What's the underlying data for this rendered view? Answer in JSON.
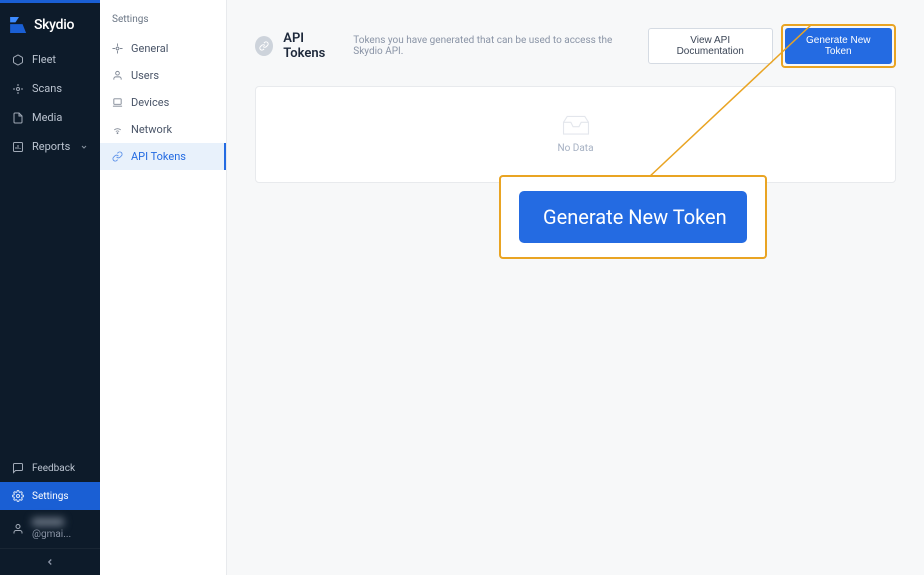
{
  "brand": {
    "name": "Skydio"
  },
  "primary_nav": {
    "items": [
      {
        "label": "Fleet",
        "icon": "cube"
      },
      {
        "label": "Scans",
        "icon": "scan"
      },
      {
        "label": "Media",
        "icon": "document"
      },
      {
        "label": "Reports",
        "icon": "report",
        "has_children": true
      }
    ],
    "footer": [
      {
        "label": "Feedback",
        "icon": "chat"
      },
      {
        "label": "Settings",
        "icon": "gear",
        "active": true
      }
    ],
    "user_suffix": "@gmai..."
  },
  "secondary_nav": {
    "title": "Settings",
    "items": [
      {
        "label": "General",
        "icon": "gear"
      },
      {
        "label": "Users",
        "icon": "user"
      },
      {
        "label": "Devices",
        "icon": "device"
      },
      {
        "label": "Network",
        "icon": "wifi"
      },
      {
        "label": "API Tokens",
        "icon": "link",
        "active": true
      }
    ]
  },
  "page": {
    "title": "API Tokens",
    "subtitle": "Tokens you have generated that can be used to access the Skydio API.",
    "actions": {
      "view_docs": "View API Documentation",
      "generate": "Generate New Token"
    },
    "empty_text": "No Data"
  },
  "callout": {
    "button_label": "Generate New Token"
  }
}
